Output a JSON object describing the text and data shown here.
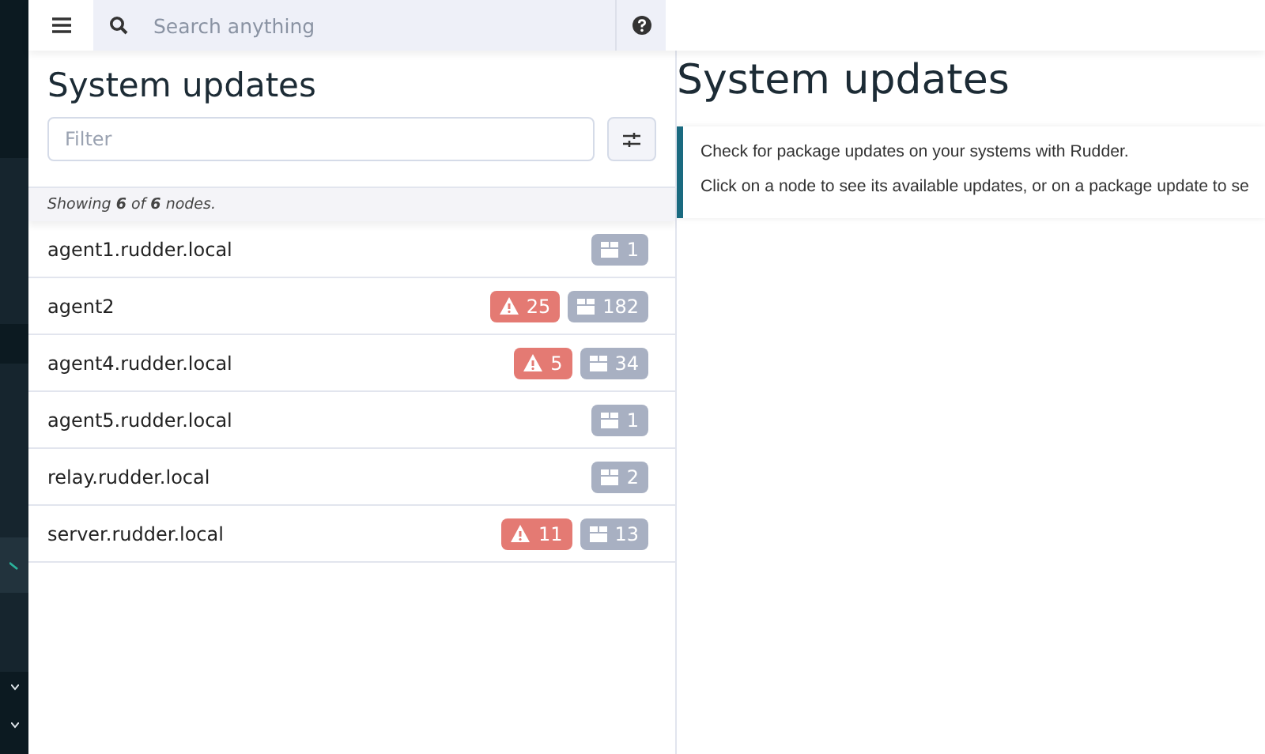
{
  "topbar": {
    "search": {
      "placeholder": "Search anything"
    }
  },
  "list_panel": {
    "title": "System updates",
    "filter": {
      "placeholder": "Filter"
    },
    "summary": "Showing **6** of **6** nodes.",
    "nodes": [
      {
        "name": "agent1.rudder.local",
        "updates": "1"
      },
      {
        "name": "agent2",
        "security": "25",
        "updates": "182"
      },
      {
        "name": "agent4.rudder.local",
        "security": "5",
        "updates": "34"
      },
      {
        "name": "agent5.rudder.local",
        "updates": "1"
      },
      {
        "name": "relay.rudder.local",
        "updates": "2"
      },
      {
        "name": "server.rudder.local",
        "security": "11",
        "updates": "13"
      }
    ]
  },
  "detail_panel": {
    "title": "System updates",
    "info": [
      "Check for package updates on your systems with Rudder.",
      "Click on a node to see its available updates, or on a package update to se"
    ]
  }
}
